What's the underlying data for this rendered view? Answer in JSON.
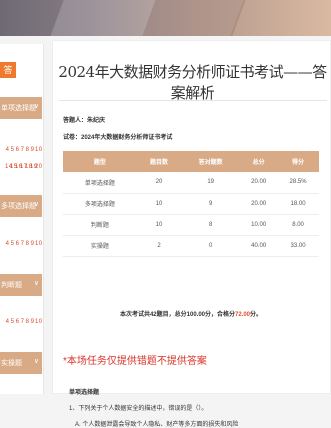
{
  "exam": {
    "title": "2024年大数据财务分析师证书考试——答案解析",
    "student_label": "答题人：朱纪庆",
    "paper_label": "试卷：2024年大数据财务分析师证书考试",
    "score_columns": [
      "题型",
      "题目数",
      "答对题数",
      "总分",
      "得分"
    ],
    "score_rows": [
      [
        "单项选择题",
        "20",
        "19",
        "20.00",
        "28.5%"
      ],
      [
        "多项选择题",
        "10",
        "9",
        "20.00",
        "18.00"
      ],
      [
        "判断题",
        "10",
        "8",
        "10.00",
        "8.00"
      ],
      [
        "实操题",
        "2",
        "0",
        "40.00",
        "33.00"
      ]
    ],
    "totals_prefix": "本次考试共42题目，总分100.00分，合格分",
    "totals_pass": "72.00",
    "totals_suffix": "分。",
    "notice": "*本场任务仅提供错题不提供答案",
    "section_heading": "单项选择题",
    "question_1": "1、下列关于个人数据安全的描述中，错误的是（）。",
    "question_1_option": "A. 个人数据泄露会导致个人隐私、财产等多方面的损失和风险"
  },
  "sidebar": {
    "tag": "答",
    "sections": [
      {
        "label": "单项选择题",
        "chevron": "∨"
      },
      {
        "label": "多项选择题",
        "chevron": "∨"
      },
      {
        "label": "判断题",
        "chevron": "∨"
      },
      {
        "label": "实操题",
        "chevron": "∨"
      }
    ],
    "row1": [
      "4",
      "5",
      "6",
      "7",
      "8",
      "9",
      "10"
    ],
    "row2": [
      "14",
      "15",
      "16",
      "17",
      "18",
      "19",
      "20"
    ],
    "row3": [
      "4",
      "5",
      "6",
      "7",
      "8",
      "9",
      "10"
    ],
    "row4": [
      "4",
      "5",
      "6",
      "7",
      "8",
      "9",
      "10"
    ]
  }
}
